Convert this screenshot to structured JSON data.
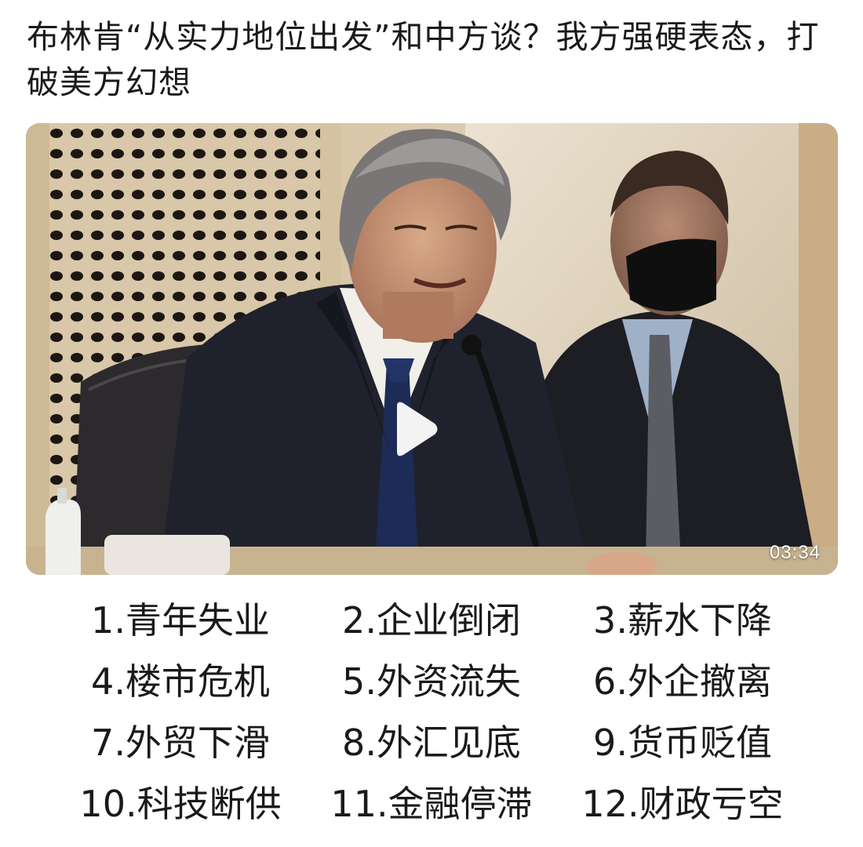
{
  "post": {
    "title": "布林肯“从实力地位出发”和中方谈？我方强硬表态，打破美方幻想"
  },
  "video": {
    "duration": "03:34",
    "play_icon": "play-icon"
  },
  "issues": [
    "1.青年失业",
    "2.企业倒闭",
    "3.薪水下降",
    "4.楼市危机",
    "5.外资流失",
    "6.外企撤离",
    "7.外贸下滑",
    "8.外汇见底",
    "9.货币贬值",
    "10.科技断供",
    "11.金融停滞",
    "12.财政亏空"
  ]
}
